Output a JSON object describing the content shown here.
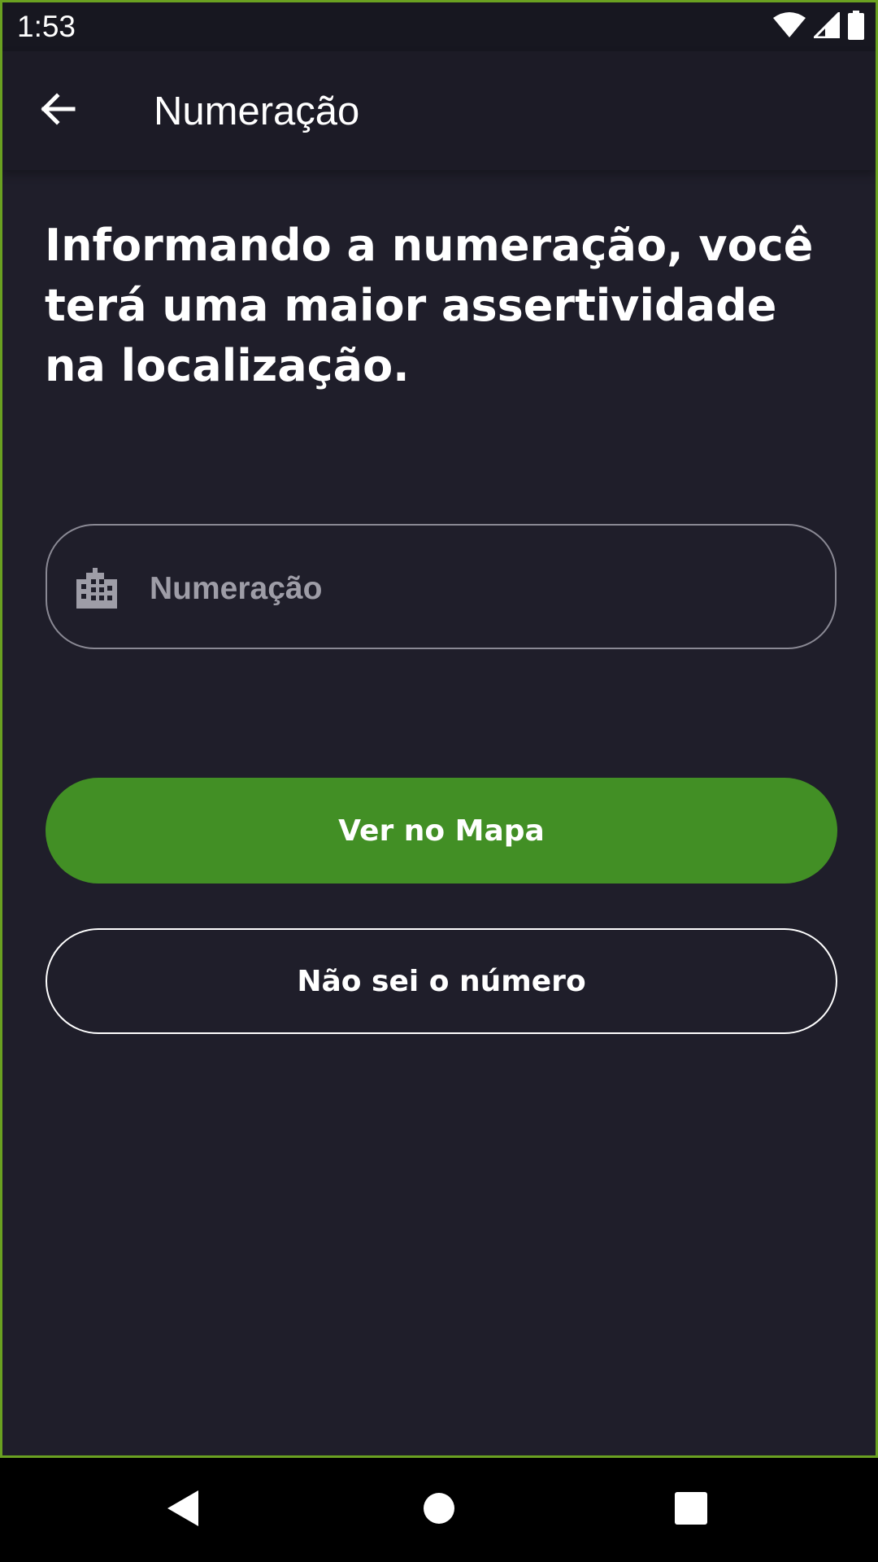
{
  "status_bar": {
    "time": "1:53",
    "icons": [
      "wifi-icon",
      "cellular-signal-icon",
      "battery-icon"
    ]
  },
  "app_bar": {
    "title": "Numeração",
    "back_icon": "arrow-left-icon"
  },
  "headline": "Informando a numeração, você terá uma maior assertividade na localização.",
  "number_field": {
    "icon": "building-icon",
    "placeholder": "Numeração",
    "value": ""
  },
  "buttons": {
    "map_label": "Ver no Mapa",
    "unknown_label": "Não sei o número"
  },
  "nav_bar": {
    "icons": [
      "nav-back-icon",
      "nav-home-icon",
      "nav-recents-icon"
    ]
  },
  "colors": {
    "background": "#1f1e2a",
    "app_bar": "#1c1b26",
    "primary_green": "#428f25",
    "frame_border": "#6aa121",
    "input_border": "#8a8994",
    "placeholder": "#9e9da7",
    "text": "#ffffff"
  }
}
